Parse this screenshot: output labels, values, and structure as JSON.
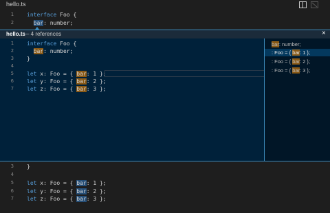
{
  "tab": {
    "title": "hello.ts"
  },
  "toolbar": {
    "split_icon": "split-editor-icon",
    "close_icon": "close-editor-icon"
  },
  "editor": {
    "lines": [
      {
        "num": "1",
        "indent": "",
        "kw": "interface",
        "rest": " Foo {"
      },
      {
        "num": "2",
        "indent": "  ",
        "sym": "bar",
        "rest": ": number;"
      }
    ]
  },
  "peek": {
    "title": "hello.ts",
    "subtitle": " – 4 references",
    "close_label": "×",
    "code": [
      {
        "num": "1",
        "kw": "interface",
        "rest": " Foo {"
      },
      {
        "num": "2",
        "indent": "  ",
        "sym": "bar",
        "rest": ": number;"
      },
      {
        "num": "3",
        "rest": "}"
      },
      {
        "num": "4",
        "rest": ""
      },
      {
        "num": "5",
        "kw": "let",
        "pre": " x: Foo = { ",
        "sym": "bar",
        "rest": ": 1 };"
      },
      {
        "num": "6",
        "kw": "let",
        "pre": " y: Foo = { ",
        "sym": "bar",
        "rest": ": 2 };"
      },
      {
        "num": "7",
        "kw": "let",
        "pre": " z: Foo = { ",
        "sym": "bar",
        "rest": ": 3 };"
      }
    ],
    "references": [
      {
        "sym": "bar",
        "rest": ": number;"
      },
      {
        "pre": ": Foo = { ",
        "sym": "bar",
        "rest": ": 1 };"
      },
      {
        "pre": ": Foo = { ",
        "sym": "bar",
        "rest": ": 2 };"
      },
      {
        "pre": ": Foo = { ",
        "sym": "bar",
        "rest": ": 3 };"
      }
    ]
  },
  "lower": {
    "lines": [
      {
        "num": "3",
        "rest": "}"
      },
      {
        "num": "4",
        "rest": ""
      },
      {
        "num": "5",
        "kw": "let",
        "pre": " x: Foo = { ",
        "sym": "bar",
        "rest": ": 1 };"
      },
      {
        "num": "6",
        "kw": "let",
        "pre": " y: Foo = { ",
        "sym": "bar",
        "rest": ": 2 };"
      },
      {
        "num": "7",
        "kw": "let",
        "pre": " z: Foo = { ",
        "sym": "bar",
        "rest": ": 3 };"
      }
    ]
  }
}
